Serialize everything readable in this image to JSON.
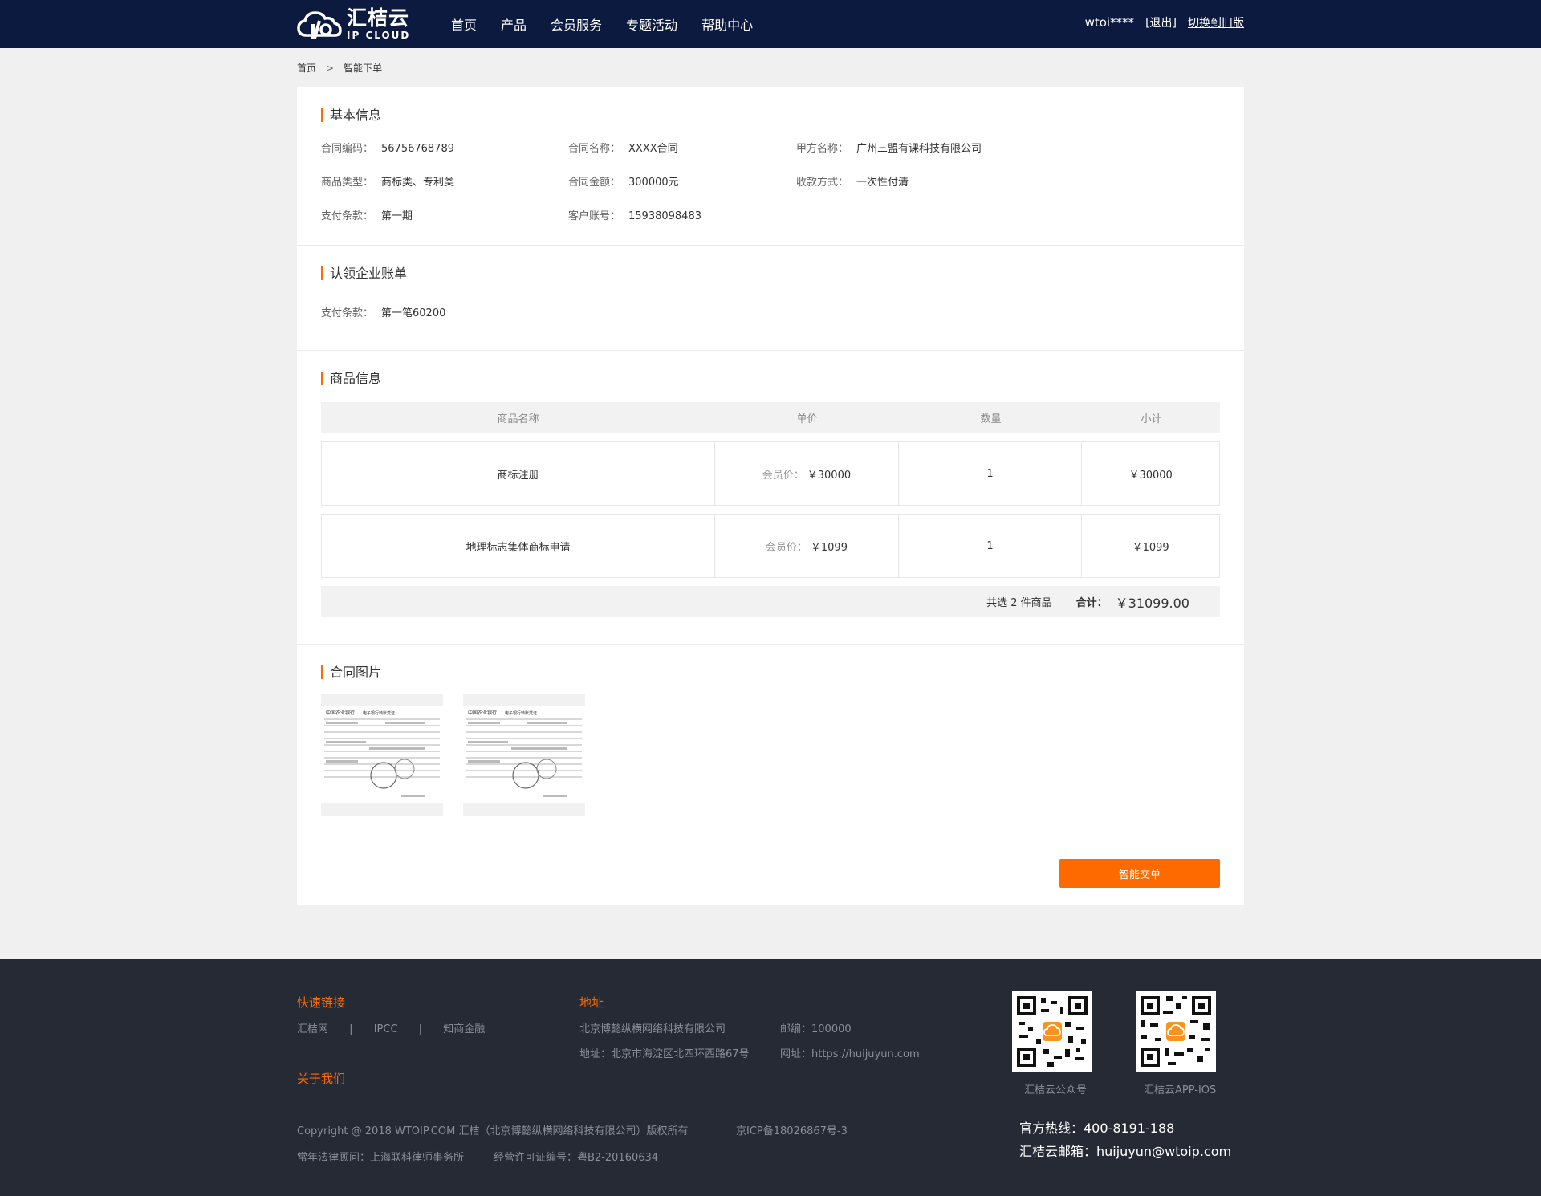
{
  "header": {
    "logo_cn": "汇桔云",
    "logo_en": "IP CLOUD",
    "nav": [
      "首页",
      "产品",
      "会员服务",
      "专题活动",
      "帮助中心"
    ],
    "username": "wtoi****",
    "logout": "[退出]",
    "switch_old": "切换到旧版"
  },
  "breadcrumb": {
    "home": "首页",
    "sep": ">",
    "current": "智能下单"
  },
  "basic": {
    "title": "基本信息",
    "contract_no_label": "合同编码：",
    "contract_no": "56756768789",
    "contract_name_label": "合同名称：",
    "contract_name": "XXXX合同",
    "party_a_label": "甲方名称：",
    "party_a": "广州三盟有课科技有限公司",
    "goods_type_label": "商品类型：",
    "goods_type": "商标类、专利类",
    "amount_label": "合同金额：",
    "amount": "300000元",
    "collect_label": "收款方式：",
    "collect": "一次性付清",
    "pay_terms_label": "支付条款：",
    "pay_terms": "第一期",
    "account_label": "客户账号：",
    "account": "15938098483"
  },
  "bill": {
    "title": "认领企业账单",
    "pay_terms_label": "支付条款：",
    "pay_terms": "第一笔60200"
  },
  "goods": {
    "title": "商品信息",
    "headers": [
      "商品名称",
      "单价",
      "数量",
      "小计"
    ],
    "price_prefix": "会员价：",
    "rows": [
      {
        "name": "商标注册",
        "price": "￥30000",
        "qty": "1",
        "subtotal": "￥30000"
      },
      {
        "name": "地理标志集体商标申请",
        "price": "￥1099",
        "qty": "1",
        "subtotal": "￥1099"
      }
    ],
    "count_text": "共选 2 件商品",
    "total_label": "合计：",
    "total": "￥31099.00"
  },
  "images": {
    "title": "合同图片",
    "bank_name": "中国农业银行",
    "doc_title": "电子银行转账凭证"
  },
  "actions": {
    "submit": "智能交单"
  },
  "footer": {
    "links_title": "快速链接",
    "links": [
      "汇桔网",
      "IPCC",
      "知商金融"
    ],
    "link_sep": "|",
    "about_title": "关于我们",
    "addr_title": "地址",
    "company": "北京博懿纵横网络科技有限公司",
    "address": "地址：北京市海淀区北四环西路67号",
    "zip": "邮编：100000",
    "website": "网址：https://huijuyun.com",
    "copyright": "Copyright @ 2018 WTOIP.COM 汇桔（北京博懿纵横网络科技有限公司）版权所有",
    "icp": "京ICP备18026867号-3",
    "lawyer": "常年法律顾问：上海联科律师事务所",
    "license": "经营许可证编号：粤B2-20160634",
    "qr1_label": "汇桔云公众号",
    "qr2_label": "汇桔云APP-IOS",
    "hotline": "官方热线：400-8191-188",
    "email": "汇桔云邮箱：huijuyun@wtoip.com"
  },
  "colors": {
    "accent": "#ff6a00",
    "topbar": "#0d1a40",
    "footer": "#262a34"
  }
}
